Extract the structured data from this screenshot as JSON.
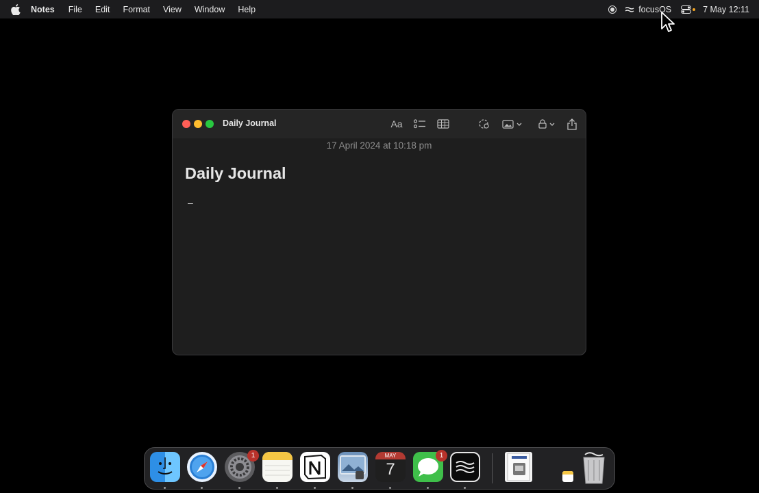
{
  "menubar": {
    "app_name": "Notes",
    "menus": [
      "File",
      "Edit",
      "Format",
      "View",
      "Window",
      "Help"
    ],
    "focus_label": "focusOS",
    "clock": "7 May  12:11"
  },
  "window": {
    "title": "Daily Journal",
    "toolbar": {
      "format_label": "Aa"
    },
    "note": {
      "date": "17 April 2024 at 10:18 pm",
      "heading": "Daily Journal",
      "body": "–"
    }
  },
  "dock": {
    "apps": [
      "finder",
      "safari",
      "system-settings",
      "notes",
      "notion",
      "preview",
      "calendar",
      "messages",
      "focusos"
    ],
    "badges": {
      "settings": "1",
      "messages": "1"
    },
    "calendar": {
      "month": "MAY",
      "day": "7"
    }
  },
  "colors": {
    "close": "#ff5f57",
    "minimize": "#febc2e",
    "maximize": "#28c840",
    "badge": "#b8322b",
    "window_bg": "#1e1e1e"
  }
}
